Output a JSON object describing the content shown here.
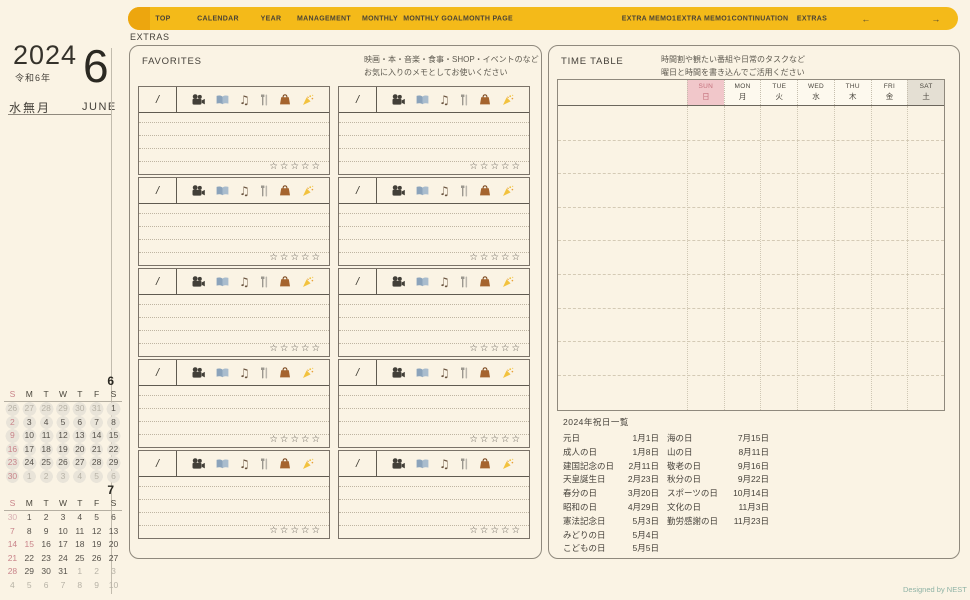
{
  "page": {
    "designed_by": "Designed by NEST"
  },
  "nav": {
    "bar_color": "#f4ba19",
    "section_label": "EXTRAS",
    "items": [
      {
        "label": "TOP"
      },
      {
        "label": "CALENDAR"
      },
      {
        "label": "YEAR"
      },
      {
        "label": "MANAGEMENT"
      },
      {
        "label": "MONTHLY"
      },
      {
        "label": "MONTHLY GOAL"
      },
      {
        "label": "MONTH PAGE"
      },
      {
        "label": "EXTRA MEMO1"
      },
      {
        "label": "EXTRA MEMO1"
      },
      {
        "label": "CONTINUATION"
      },
      {
        "label": "EXTRAS"
      },
      {
        "label": "←"
      },
      {
        "label": "→"
      }
    ]
  },
  "sidebar": {
    "year": "2024",
    "wareki": "令和6年",
    "month_number": "6",
    "month_jp": "水無月",
    "month_en": "JUNE"
  },
  "mini_calendars": {
    "day_headers": [
      "S",
      "M",
      "T",
      "W",
      "T",
      "F",
      "S"
    ],
    "june": {
      "label": "6",
      "circled": true,
      "weeks": [
        [
          "26",
          "27",
          "28",
          "29",
          "30",
          "31",
          "1"
        ],
        [
          "2",
          "3",
          "4",
          "5",
          "6",
          "7",
          "8"
        ],
        [
          "9",
          "10",
          "11",
          "12",
          "13",
          "14",
          "15"
        ],
        [
          "16",
          "17",
          "18",
          "19",
          "20",
          "21",
          "22"
        ],
        [
          "23",
          "24",
          "25",
          "26",
          "27",
          "28",
          "29"
        ],
        [
          "30",
          "1",
          "2",
          "3",
          "4",
          "5",
          "6"
        ]
      ],
      "marks": [
        [
          "o",
          "o",
          "o",
          "o",
          "o",
          "o",
          ""
        ],
        [
          "s",
          "",
          "",
          "",
          "",
          "",
          ""
        ],
        [
          "s",
          "",
          "",
          "",
          "",
          "",
          ""
        ],
        [
          "s",
          "",
          "",
          "",
          "",
          "",
          ""
        ],
        [
          "s",
          "",
          "",
          "",
          "",
          "",
          ""
        ],
        [
          "s",
          "o",
          "o",
          "o",
          "o",
          "o",
          "o"
        ]
      ]
    },
    "july": {
      "label": "7",
      "circled": false,
      "weeks": [
        [
          "30",
          "1",
          "2",
          "3",
          "4",
          "5",
          "6"
        ],
        [
          "7",
          "8",
          "9",
          "10",
          "11",
          "12",
          "13"
        ],
        [
          "14",
          "15",
          "16",
          "17",
          "18",
          "19",
          "20"
        ],
        [
          "21",
          "22",
          "23",
          "24",
          "25",
          "26",
          "27"
        ],
        [
          "28",
          "29",
          "30",
          "31",
          "1",
          "2",
          "3"
        ],
        [
          "4",
          "5",
          "6",
          "7",
          "8",
          "9",
          "10"
        ]
      ],
      "marks": [
        [
          "os",
          "",
          "",
          "",
          "",
          "",
          ""
        ],
        [
          "s",
          "",
          "",
          "",
          "",
          "",
          ""
        ],
        [
          "s",
          "h",
          "",
          "",
          "",
          "",
          ""
        ],
        [
          "s",
          "",
          "",
          "",
          "",
          "",
          ""
        ],
        [
          "s",
          "",
          "",
          "",
          "o",
          "o",
          "o"
        ],
        [
          "o",
          "o",
          "o",
          "o",
          "o",
          "o",
          "o"
        ]
      ]
    }
  },
  "favorites": {
    "title": "FAVORITES",
    "desc1": "映画・本・音楽・食事・SHOP・イベントのなど",
    "desc2": "お気に入りのメモとしてお使いください",
    "box_count": 10,
    "box": {
      "slash": "/",
      "icons": [
        "movie-camera",
        "open-book",
        "music-notes",
        "fork-knife",
        "handbag",
        "party-popper"
      ],
      "stars": "☆☆☆☆☆"
    }
  },
  "timetable": {
    "title": "TIME TABLE",
    "desc1": "時間割や観たい番組や日常のタスクなど",
    "desc2": "曜日と時間を書き込んでご活用ください",
    "sun_bg": "#f1c7ca",
    "sat_bg": "#e4dfd3",
    "days": [
      {
        "en": "SUN",
        "ja": "日"
      },
      {
        "en": "MON",
        "ja": "月"
      },
      {
        "en": "TUE",
        "ja": "火"
      },
      {
        "en": "WED",
        "ja": "水"
      },
      {
        "en": "THU",
        "ja": "木"
      },
      {
        "en": "FRI",
        "ja": "金"
      },
      {
        "en": "SAT",
        "ja": "土"
      }
    ]
  },
  "holidays": {
    "title": "2024年祝日一覧",
    "left": [
      {
        "name": "元日",
        "date": "1月1日"
      },
      {
        "name": "成人の日",
        "date": "1月8日"
      },
      {
        "name": "建国記念の日",
        "date": "2月11日"
      },
      {
        "name": "天皇誕生日",
        "date": "2月23日"
      },
      {
        "name": "春分の日",
        "date": "3月20日"
      },
      {
        "name": "昭和の日",
        "date": "4月29日"
      },
      {
        "name": "憲法記念日",
        "date": "5月3日"
      },
      {
        "name": "みどりの日",
        "date": "5月4日"
      },
      {
        "name": "こどもの日",
        "date": "5月5日"
      }
    ],
    "right": [
      {
        "name": "海の日",
        "date": "7月15日"
      },
      {
        "name": "山の日",
        "date": "8月11日"
      },
      {
        "name": "敬老の日",
        "date": "9月16日"
      },
      {
        "name": "秋分の日",
        "date": "9月22日"
      },
      {
        "name": "スポーツの日",
        "date": "10月14日"
      },
      {
        "name": "文化の日",
        "date": "11月3日"
      },
      {
        "name": "勤労感謝の日",
        "date": "11月23日"
      }
    ]
  }
}
